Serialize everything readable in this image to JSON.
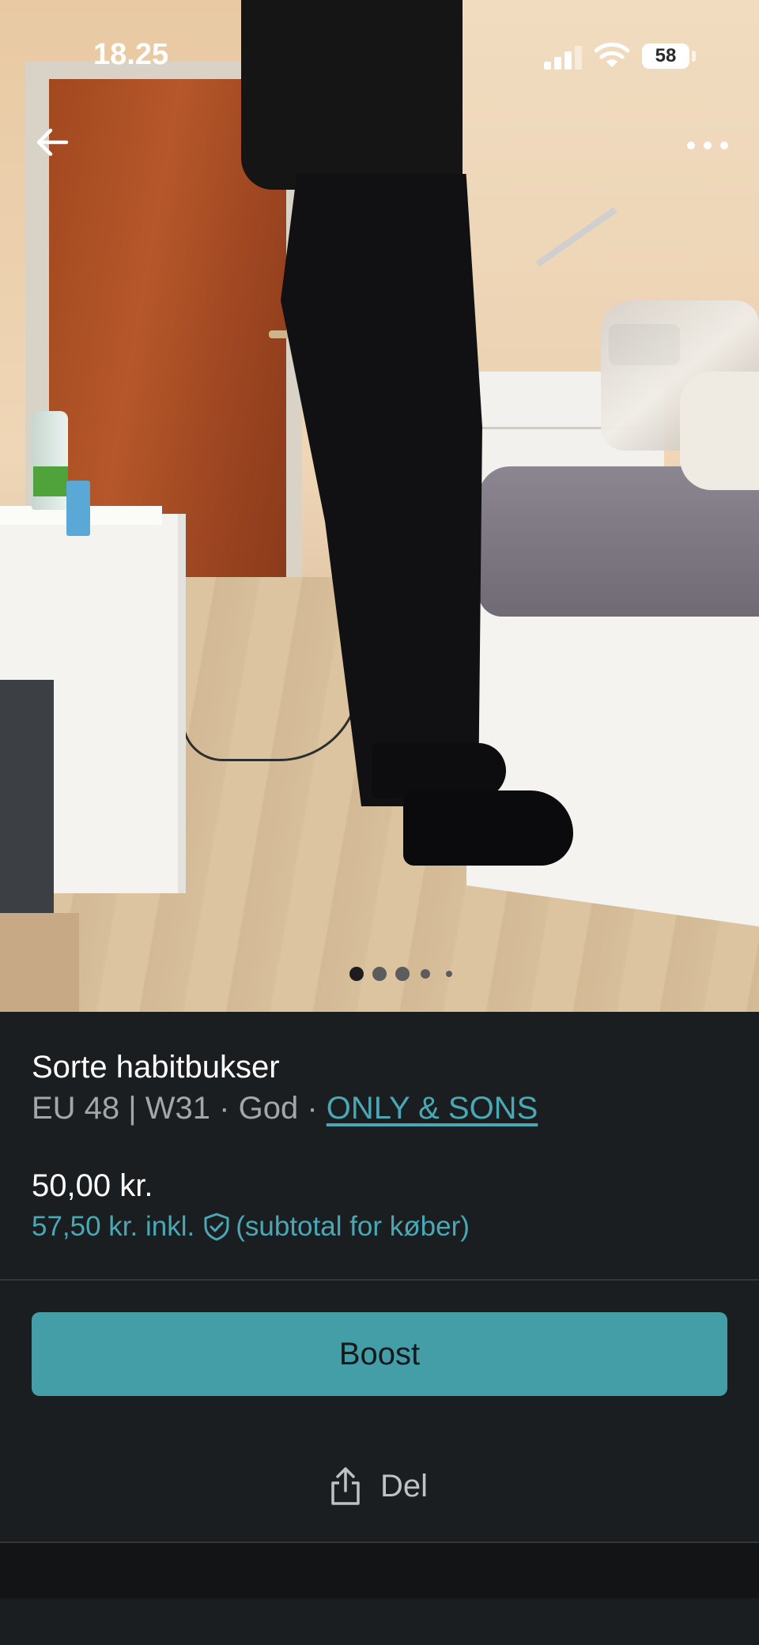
{
  "status_bar": {
    "time": "18.25",
    "battery": "58"
  },
  "gallery": {
    "image_count": 5,
    "active_index": 0
  },
  "listing": {
    "title": "Sorte habitbukser",
    "size": "EU 48 | W31",
    "separator_1": " · ",
    "condition": "God",
    "separator_2": " · ",
    "brand": "ONLY & SONS",
    "price": "50,00 kr.",
    "price_incl": "57,50 kr. inkl.",
    "price_incl_note": "(subtotal for køber)"
  },
  "actions": {
    "boost_label": "Boost",
    "share_label": "Del"
  },
  "colors": {
    "accent": "#449ea8",
    "link": "#4aa8b4",
    "background": "#1b1e21"
  },
  "icons": {
    "back": "arrow-left-icon",
    "more": "more-horizontal-icon",
    "protection": "shield-check-icon",
    "share": "share-icon"
  }
}
